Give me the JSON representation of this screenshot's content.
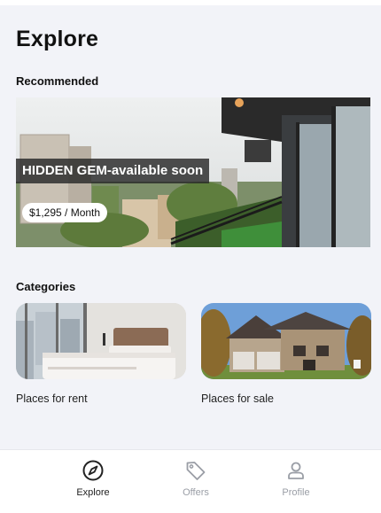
{
  "page": {
    "title": "Explore"
  },
  "recommended": {
    "heading": "Recommended",
    "listing": {
      "title": "HIDDEN GEM-available soon",
      "price": "$1,295 / Month"
    }
  },
  "categories": {
    "heading": "Categories",
    "items": [
      {
        "label": "Places for rent"
      },
      {
        "label": "Places for sale"
      }
    ]
  },
  "nav": {
    "items": [
      {
        "label": "Explore",
        "icon": "compass-icon",
        "active": true
      },
      {
        "label": "Offers",
        "icon": "tag-icon",
        "active": false
      },
      {
        "label": "Profile",
        "icon": "user-icon",
        "active": false
      }
    ],
    "active_color": "#222222",
    "inactive_color": "#9a9ea6"
  }
}
